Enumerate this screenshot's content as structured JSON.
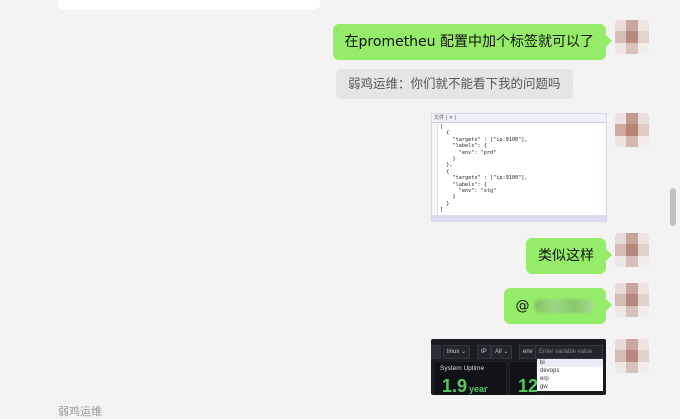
{
  "chat": {
    "messages": [
      {
        "type": "text",
        "side": "right",
        "text": "在prometheu 配置中加个标签就可以了"
      },
      {
        "type": "system",
        "text": "弱鸡运维：你们就不能看下我的问题吗"
      },
      {
        "type": "image",
        "side": "right",
        "description": "code-screenshot"
      },
      {
        "type": "text",
        "side": "right",
        "text": "类似这样"
      },
      {
        "type": "mention",
        "side": "right",
        "text": "@"
      },
      {
        "type": "image",
        "side": "right",
        "description": "grafana-screenshot"
      }
    ]
  },
  "code_image": {
    "tab": "文件 | ✕ |",
    "code": "[\n  {\n    \"targets\" : [\"ip:9100\"],\n    \"labels\": {\n      \"env\": \"prd\"\n    }\n  },\n  {\n    \"targets\" : [\"ip:9100\"],\n    \"labels\": {\n      \"env\": \"stg\"\n    }\n  }\n]"
  },
  "dashboard_image": {
    "tag1": "linux",
    "ip_label": "IP",
    "ip_value": "All",
    "env_label": "env",
    "env_placeholder": "Enter variable value",
    "env_options": [
      "bi",
      "devops",
      "erp",
      "gw"
    ],
    "panel_title": "System Uptime",
    "panel_value": "1.9",
    "panel_unit": "year",
    "panel2_value": "12"
  },
  "footer": {
    "partial_name": "弱鸡运维"
  },
  "colors": {
    "bubble_green": "#95ec69",
    "background": "#f3f3f3"
  }
}
